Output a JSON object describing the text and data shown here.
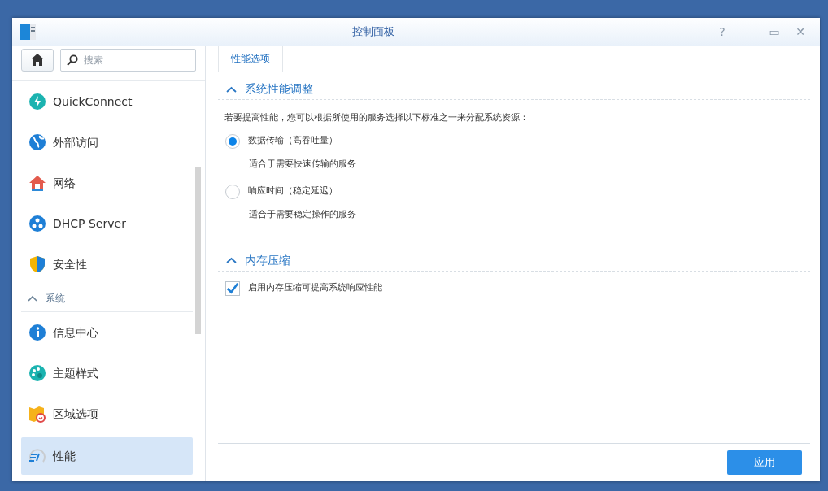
{
  "window": {
    "title": "控制面板",
    "controls": [
      "?",
      "—",
      "▭",
      "✕"
    ]
  },
  "search": {
    "placeholder": "搜索"
  },
  "sidebar": {
    "items": [
      {
        "kind": "item",
        "label": "QuickConnect",
        "selected": false
      },
      {
        "kind": "item",
        "label": "外部访问",
        "selected": false
      },
      {
        "kind": "item",
        "label": "网络",
        "selected": false
      },
      {
        "kind": "item",
        "label": "DHCP Server",
        "selected": false
      },
      {
        "kind": "item",
        "label": "安全性",
        "selected": false
      },
      {
        "kind": "header",
        "label": "系统",
        "expanded": true
      },
      {
        "kind": "item",
        "label": "信息中心",
        "selected": false
      },
      {
        "kind": "item",
        "label": "主题样式",
        "selected": false
      },
      {
        "kind": "item",
        "label": "区域选项",
        "selected": false
      },
      {
        "kind": "item",
        "label": "性能",
        "selected": true
      }
    ]
  },
  "tabs": [
    {
      "label": "性能选项",
      "selected": true
    }
  ],
  "sections": [
    {
      "title": "系统性能调整",
      "expanded": true,
      "description": "若要提高性能，您可以根据所使用的服务选择以下标准之一来分配系统资源：",
      "options": [
        {
          "kind": "radio",
          "label": "数据传输（高吞吐量）",
          "hint": "适合于需要快速传输的服务",
          "selected": true
        },
        {
          "kind": "radio",
          "label": "响应时间（稳定延迟）",
          "hint": "适合于需要稳定操作的服务",
          "selected": false
        }
      ]
    },
    {
      "title": "内存压缩",
      "expanded": true,
      "options": [
        {
          "kind": "checkbox",
          "label": "启用内存压缩可提高系统响应性能",
          "checked": true
        }
      ]
    }
  ],
  "buttons": [
    "应用"
  ]
}
